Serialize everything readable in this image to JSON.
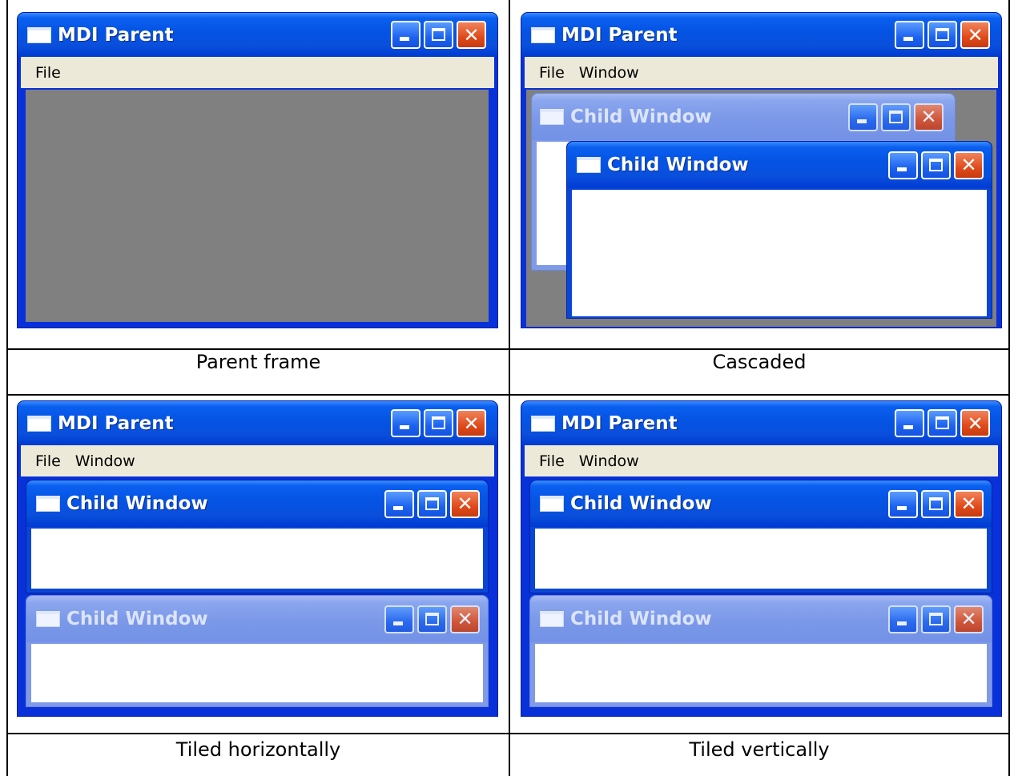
{
  "panels": [
    {
      "caption": "Parent frame",
      "parent_title": "MDI Parent",
      "menu": [
        "File"
      ],
      "children": []
    },
    {
      "caption": "Cascaded",
      "parent_title": "MDI Parent",
      "menu": [
        "File",
        "Window"
      ],
      "children": [
        {
          "title": "Child Window",
          "state": "inactive"
        },
        {
          "title": "Child Window",
          "state": "active"
        }
      ]
    },
    {
      "caption": "Tiled horizontally",
      "parent_title": "MDI Parent",
      "menu": [
        "File",
        "Window"
      ],
      "children": [
        {
          "title": "Child Window",
          "state": "active"
        },
        {
          "title": "Child Window",
          "state": "inactive"
        }
      ]
    },
    {
      "caption": "Tiled vertically",
      "parent_title": "MDI Parent",
      "menu": [
        "File",
        "Window"
      ],
      "children": [
        {
          "title": "Child Window",
          "state": "active"
        },
        {
          "title": "Child Window",
          "state": "inactive"
        }
      ]
    }
  ],
  "icons": {
    "minimize": "minimize-icon",
    "maximize": "maximize-icon",
    "close": "close-icon",
    "window": "window-icon"
  },
  "colors": {
    "titlebar_active": "#0553e3",
    "titlebar_inactive": "#7b98e8",
    "close_button": "#e04a1a",
    "mdi_client_bg": "#808080",
    "menubar_bg": "#ece9d8"
  }
}
